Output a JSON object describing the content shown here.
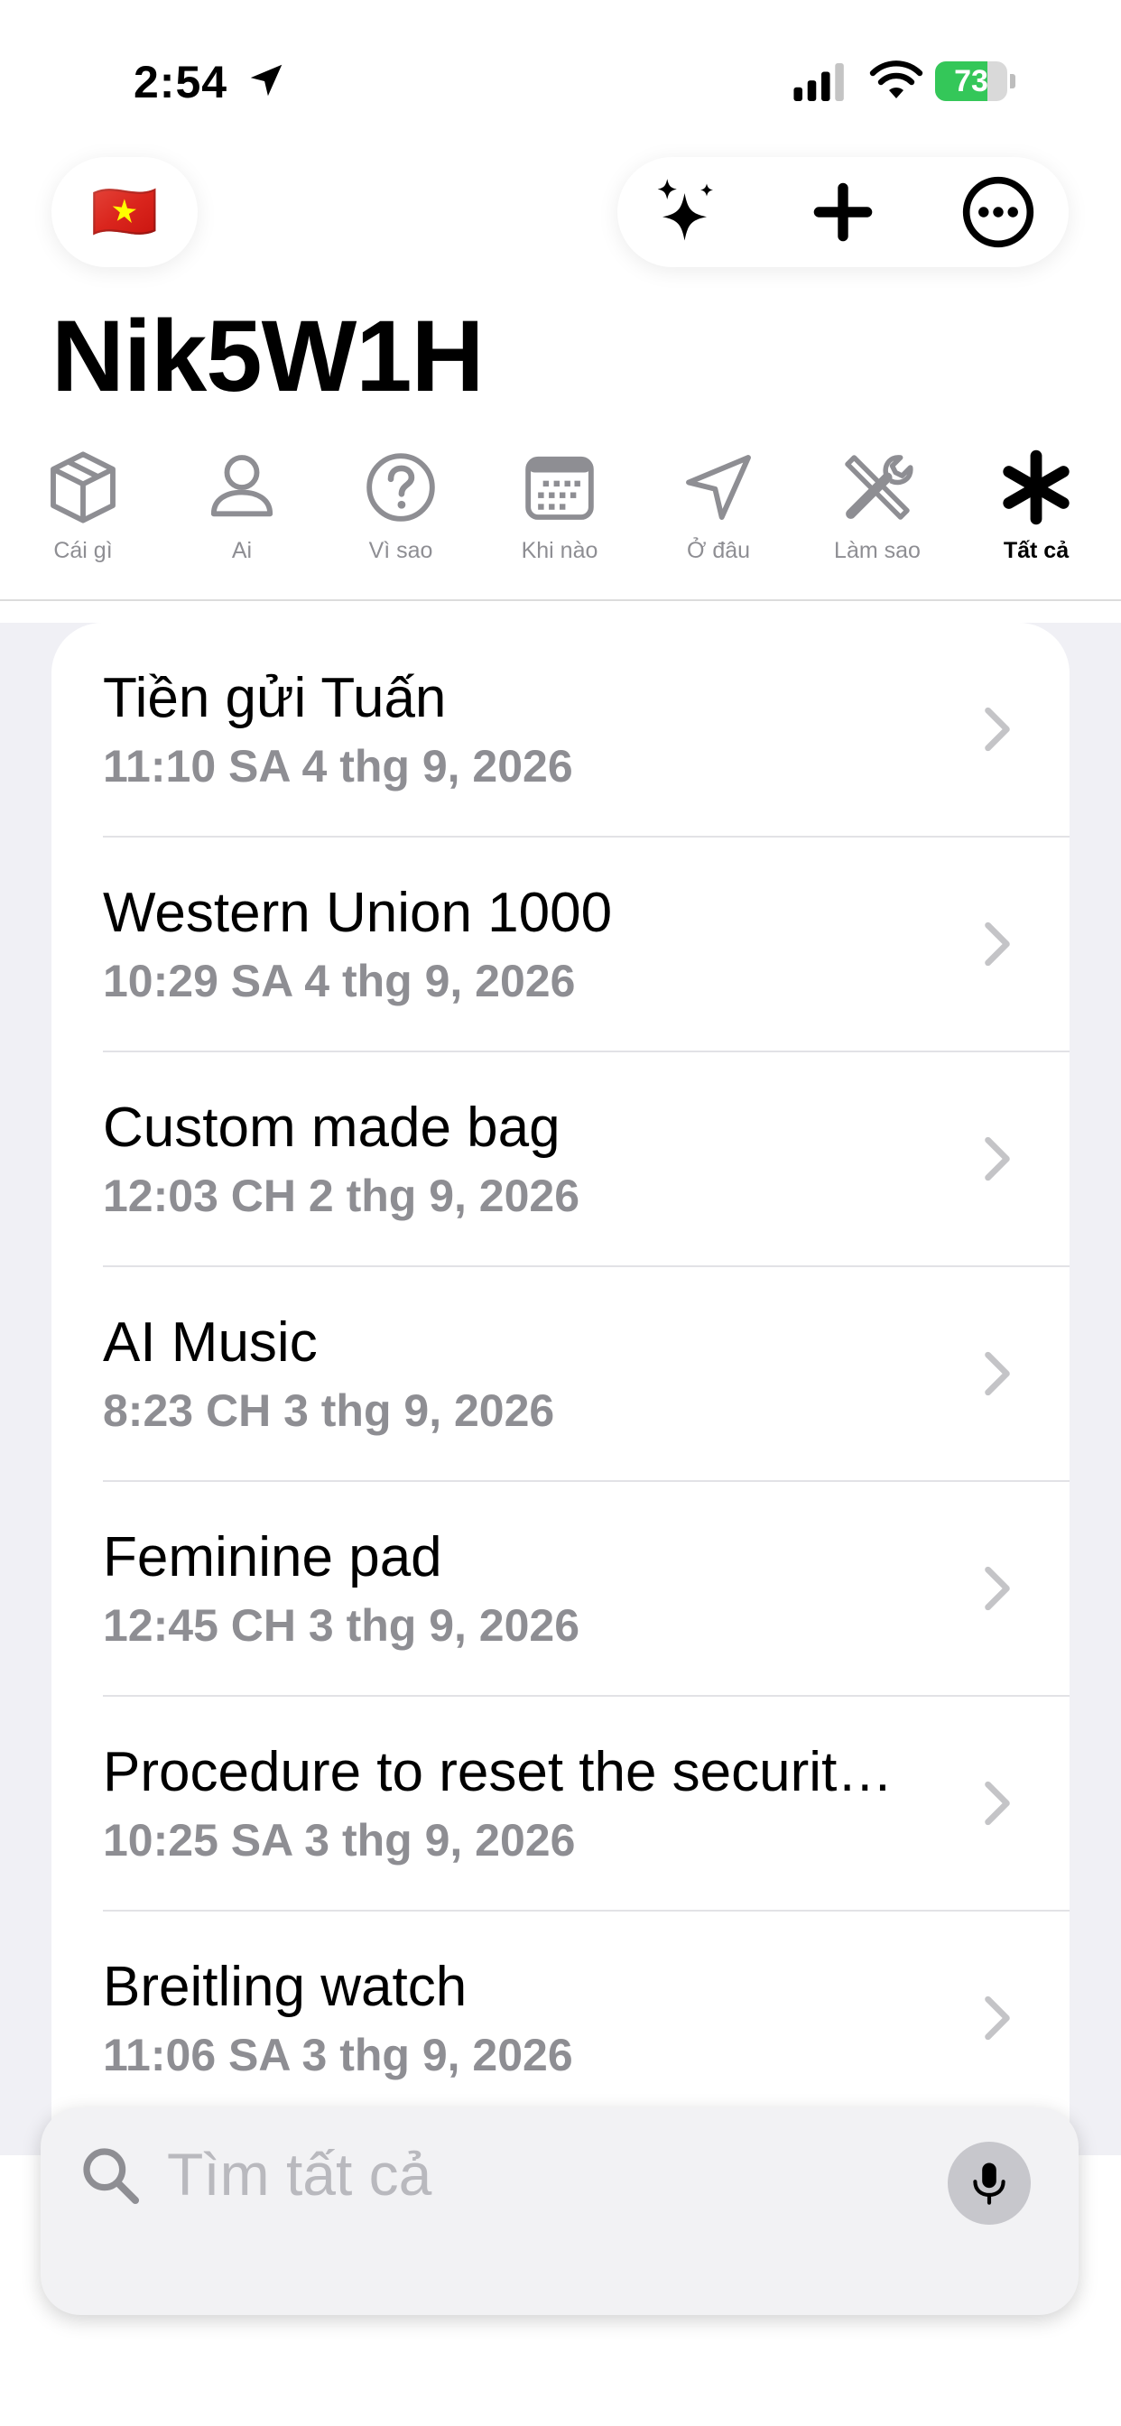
{
  "status_bar": {
    "time": "2:54",
    "battery_level": "73",
    "battery_percent": 73,
    "battery_color": "#34c759"
  },
  "header": {
    "flag_emoji": "🇻🇳",
    "title": "Nik5W1H",
    "actions": [
      "sparkles-icon",
      "plus-icon",
      "ellipsis-circle-icon"
    ]
  },
  "tabs": [
    {
      "label": "Cái gì",
      "icon": "box-icon"
    },
    {
      "label": "Ai",
      "icon": "person-icon"
    },
    {
      "label": "Vì sao",
      "icon": "question-circle-icon"
    },
    {
      "label": "Khi nào",
      "icon": "calendar-icon"
    },
    {
      "label": "Ở đâu",
      "icon": "location-arrow-icon"
    },
    {
      "label": "Làm sao",
      "icon": "tools-icon"
    },
    {
      "label": "Tất cả",
      "icon": "asterisk-icon",
      "active": true
    }
  ],
  "items": [
    {
      "title": "Tiền gửi Tuấn",
      "date": "11:10 SA 4 thg 9, 2026"
    },
    {
      "title": "Western Union 1000",
      "date": "10:29 SA 4 thg 9, 2026"
    },
    {
      "title": "Custom made bag",
      "date": "12:03 CH 2 thg 9, 2026"
    },
    {
      "title": "AI Music",
      "date": "8:23 CH 3 thg 9, 2026"
    },
    {
      "title": "Feminine pad",
      "date": "12:45 CH 3 thg 9, 2026"
    },
    {
      "title": "Procedure to reset the securit…",
      "date": "10:25 SA 3 thg 9, 2026"
    },
    {
      "title": "Breitling watch",
      "date": "11:06 SA 3 thg 9, 2026"
    }
  ],
  "search": {
    "placeholder": "Tìm tất cả"
  }
}
